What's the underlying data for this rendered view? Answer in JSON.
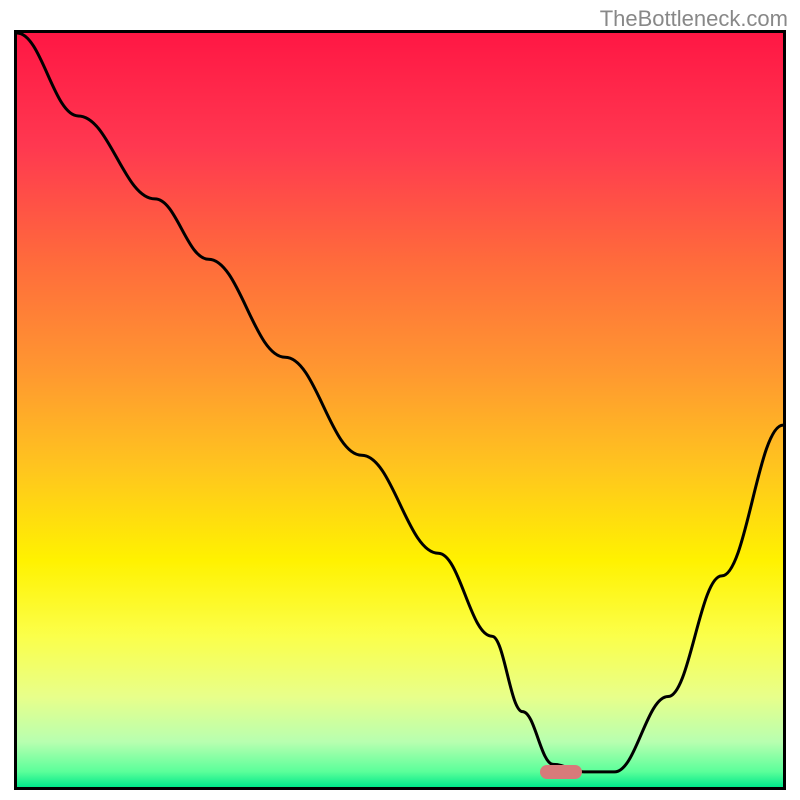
{
  "watermark": "TheBottleneck.com",
  "chart_data": {
    "type": "line",
    "title": "",
    "xlabel": "",
    "ylabel": "",
    "xlim": [
      0,
      100
    ],
    "ylim": [
      0,
      100
    ],
    "series": [
      {
        "name": "bottleneck-curve",
        "x": [
          0,
          8,
          18,
          25,
          35,
          45,
          55,
          62,
          66,
          70,
          74,
          78,
          85,
          92,
          100
        ],
        "y": [
          100,
          89,
          78,
          70,
          57,
          44,
          31,
          20,
          10,
          3,
          2,
          2,
          12,
          28,
          48
        ]
      }
    ],
    "marker": {
      "x": 71,
      "y": 2,
      "color": "#d87a7a"
    },
    "gradient_stops": [
      {
        "offset": 0,
        "color": "#ff1744"
      },
      {
        "offset": 15,
        "color": "#ff3850"
      },
      {
        "offset": 30,
        "color": "#ff6a3c"
      },
      {
        "offset": 45,
        "color": "#ff9830"
      },
      {
        "offset": 58,
        "color": "#ffc61e"
      },
      {
        "offset": 70,
        "color": "#fff200"
      },
      {
        "offset": 80,
        "color": "#fbff4a"
      },
      {
        "offset": 88,
        "color": "#e8ff8a"
      },
      {
        "offset": 94,
        "color": "#b8ffb0"
      },
      {
        "offset": 98,
        "color": "#5aff9a"
      },
      {
        "offset": 100,
        "color": "#00e88a"
      }
    ]
  }
}
